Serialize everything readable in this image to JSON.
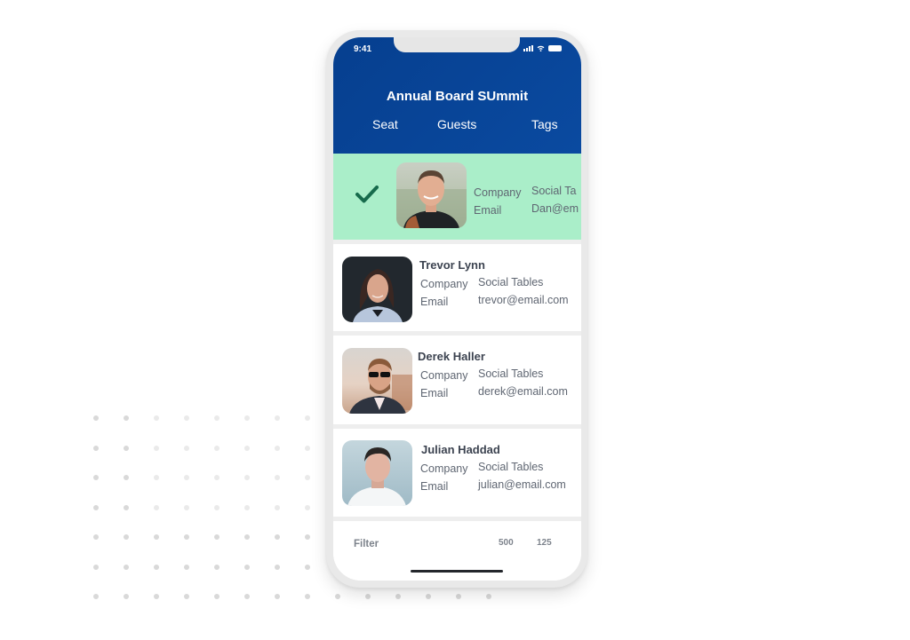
{
  "status_bar": {
    "time": "9:41",
    "icons": [
      "signal-icon",
      "wifi-icon",
      "battery-icon"
    ]
  },
  "header": {
    "title": "Annual Board SUmmit",
    "tabs": [
      {
        "label": "Seat"
      },
      {
        "label": "Guests"
      },
      {
        "label": "Tags"
      }
    ],
    "background": "#0a4aa0"
  },
  "guests": [
    {
      "name": "",
      "selected": true,
      "company_label": "Company",
      "company": "Social Ta",
      "email_label": "Email",
      "email": "Dan@em",
      "check_icon": "checkmark-icon"
    },
    {
      "name": "Trevor Lynn",
      "selected": false,
      "company_label": "Company",
      "company": "Social Tables",
      "email_label": "Email",
      "email": "trevor@email.com"
    },
    {
      "name": "Derek Haller",
      "selected": false,
      "company_label": "Company",
      "company": "Social Tables",
      "email_label": "Email",
      "email": "derek@email.com"
    },
    {
      "name": "Julian Haddad",
      "selected": false,
      "company_label": "Company",
      "company": "Social Tables",
      "email_label": "Email",
      "email": "julian@email.com"
    }
  ],
  "footer": {
    "filter_label": "Filter",
    "count_1": "500",
    "count_2": "125"
  },
  "colors": {
    "selected_row": "#aaeec9",
    "check": "#176b4c",
    "text": "#3c4350",
    "muted": "#5f6672"
  }
}
